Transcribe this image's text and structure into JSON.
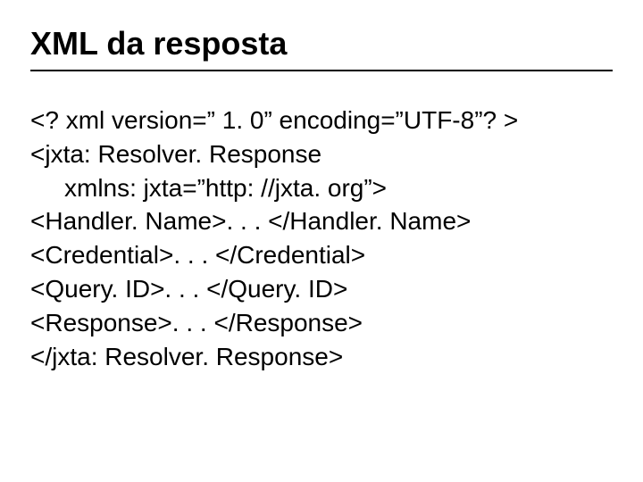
{
  "title": "XML da resposta",
  "lines": {
    "l1": "<? xml version=” 1. 0” encoding=”UTF-8”? >",
    "l2": "<jxta: Resolver. Response",
    "l3": "xmlns: jxta=”http: //jxta. org”>",
    "l4": "<Handler. Name>. . . </Handler. Name>",
    "l5": "<Credential>. . . </Credential>",
    "l6": "<Query. ID>. . . </Query. ID>",
    "l7": "<Response>. . . </Response>",
    "l8": "</jxta: Resolver. Response>"
  }
}
